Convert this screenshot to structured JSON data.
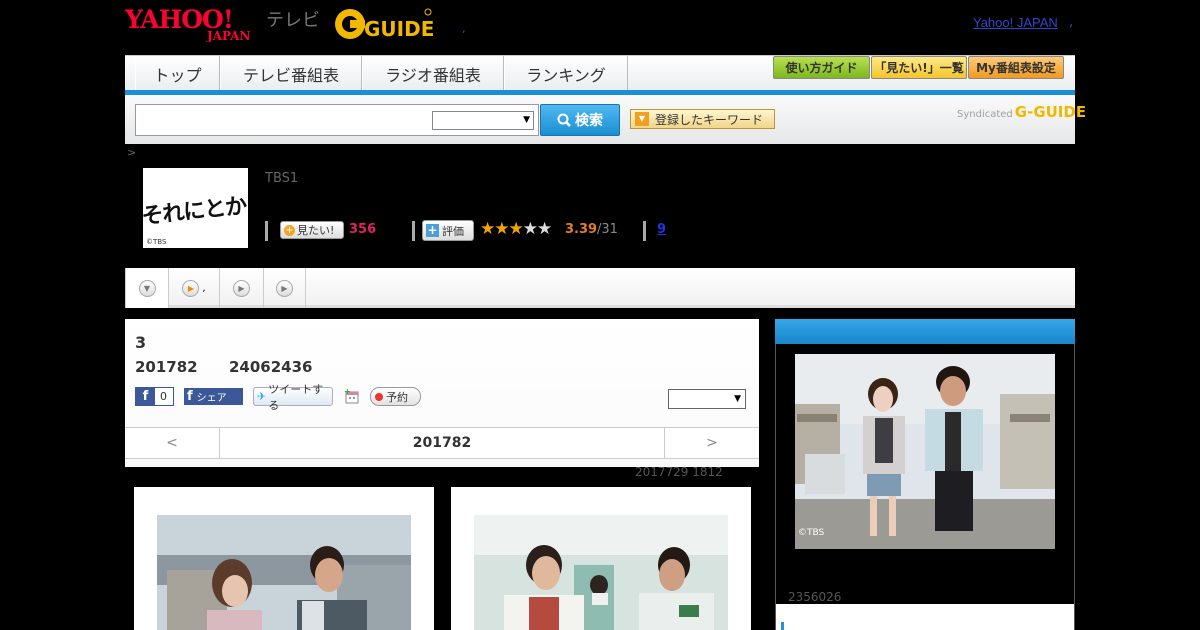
{
  "header": {
    "yahoo_logo": "YAHOO! JAPAN",
    "tv_label": "テレビ",
    "gguide_logo": "G-GUIDE",
    "yahoo_japan_link": "Yahoo! JAPAN",
    "tiny_mark": ",",
    "link_trailing": ","
  },
  "nav": {
    "tabs": [
      "トップ",
      "テレビ番組表",
      "ラジオ番組表",
      "ランキング"
    ],
    "guide_buttons": [
      "使い方ガイド",
      "「見たい!」一覧",
      "My番組表設定"
    ]
  },
  "search": {
    "input_value": "",
    "select_value": "",
    "button_label": "検索",
    "keyword_button": "登録したキーワード",
    "syndicated_label": "Syndicated",
    "syndicated_logo": "G-GUIDE"
  },
  "breadcrumb": ">",
  "program": {
    "thumb_title": "それにとかけぎす",
    "thumb_copyright": "©TBS",
    "channel": "TBS1",
    "mitai_label": "見たい!",
    "mitai_count": "356",
    "hyoka_label": "評価",
    "stars_filled": 3,
    "stars_total": 5,
    "rating": "3.39",
    "rating_count": "/31",
    "comment_count": "9"
  },
  "tabs": {
    "items": [
      "",
      ",",
      "",
      ""
    ]
  },
  "episode": {
    "title": "3",
    "date": "201782",
    "number": "24062436",
    "fb_count": "0",
    "share_label": "シェア",
    "tweet_label": "ツイートする",
    "reserve_label": "予約",
    "select_value": ""
  },
  "pager": {
    "prev": "<",
    "current": "201782",
    "next": ">"
  },
  "updated": "2017729  1812",
  "sidebar": {
    "photo_copyright": "©TBS",
    "view_count": "2356026"
  },
  "colors": {
    "accent_blue": "#1a8fd6",
    "mitai_pink": "#e02060",
    "rating_orange": "#e47d1a",
    "star_gold": "#f0a500"
  }
}
